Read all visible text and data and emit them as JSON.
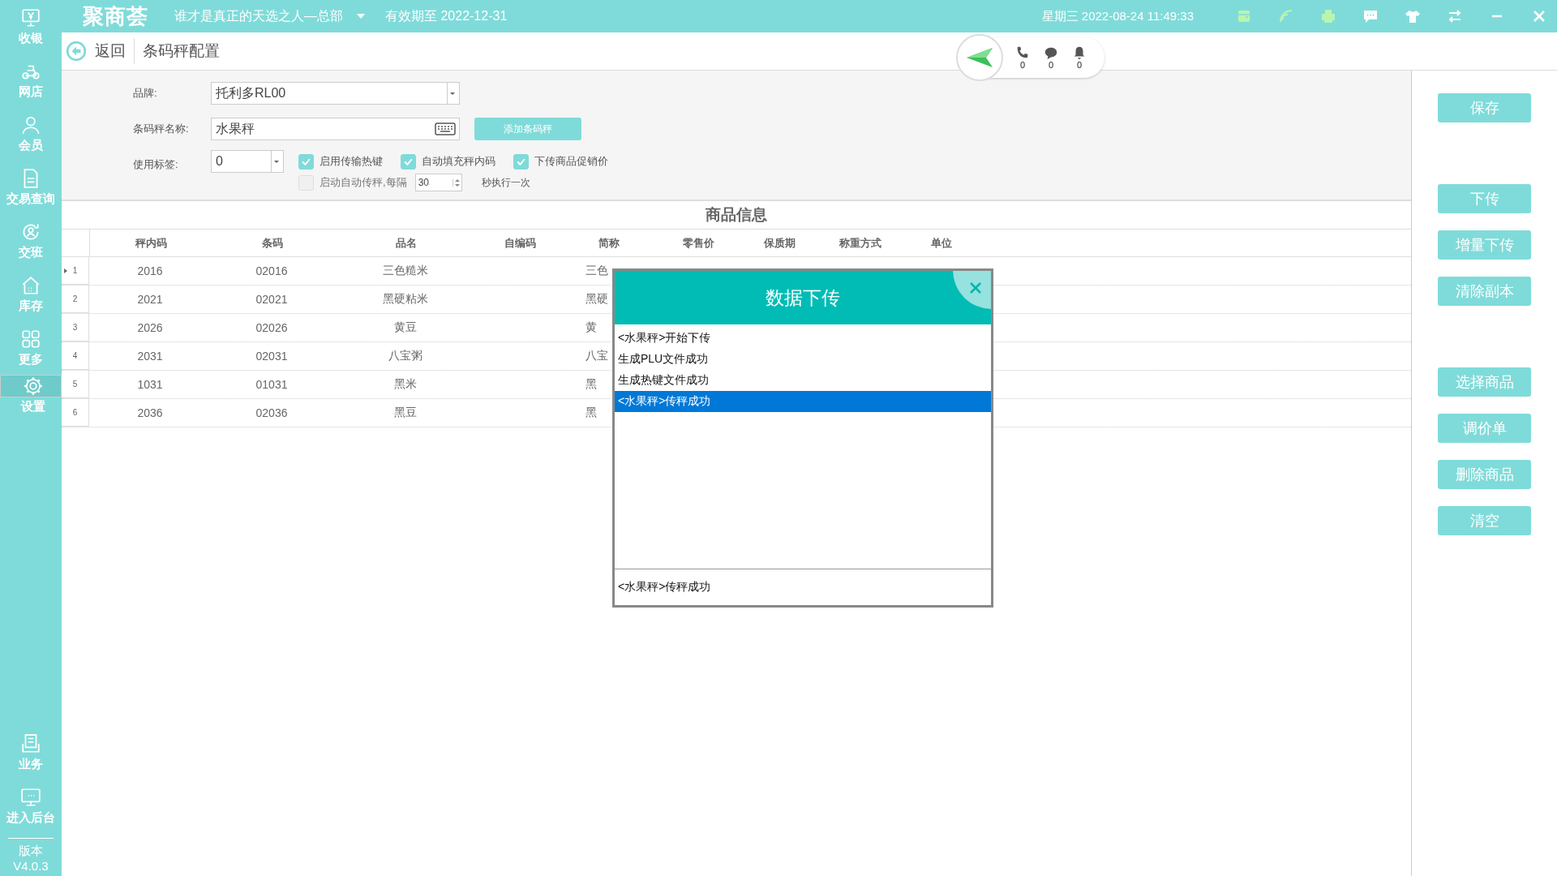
{
  "app": {
    "logo": "聚商荟",
    "store": "谁才是真正的天选之人—总部",
    "expiry": "有效期至 2022-12-31",
    "datetime": "星期三 2022-08-24 11:49:33"
  },
  "sidebar": {
    "items": [
      {
        "label": "收银",
        "selected": false
      },
      {
        "label": "网店",
        "selected": false
      },
      {
        "label": "会员",
        "selected": false
      },
      {
        "label": "交易查询",
        "selected": false
      },
      {
        "label": "交班",
        "selected": false
      },
      {
        "label": "库存",
        "selected": false
      },
      {
        "label": "更多",
        "selected": false
      },
      {
        "label": "设置",
        "selected": true
      }
    ],
    "bottom_items": [
      {
        "label": "业务"
      },
      {
        "label": "进入后台"
      }
    ],
    "version_label": "版本",
    "version": "V4.0.3"
  },
  "notifications": [
    "0",
    "0",
    "0"
  ],
  "nav": {
    "back": "返回",
    "title": "条码秤配置"
  },
  "form": {
    "brand_label": "品牌:",
    "brand": "托利多RL00",
    "name_label": "条码秤名称:",
    "name": "水果秤",
    "add_button": "添加条码秤",
    "tag_label": "使用标签:",
    "tag": "0",
    "options": [
      {
        "label": "启用传输热键",
        "checked": true
      },
      {
        "label": "自动填充秤内码",
        "checked": true
      },
      {
        "label": "下传商品促销价",
        "checked": true
      }
    ],
    "auto": {
      "label": "启动自动传秤,每隔",
      "checked": false,
      "interval": "30",
      "suffix": "秒执行一次"
    }
  },
  "table": {
    "title": "商品信息",
    "columns": [
      "秤内码",
      "条码",
      "品名",
      "自编码",
      "简称",
      "零售价",
      "保质期",
      "称重方式",
      "单位"
    ],
    "rows": [
      {
        "index": "1",
        "selected": true,
        "cells": [
          "2016",
          "02016",
          "三色糙米",
          "",
          "三色"
        ]
      },
      {
        "index": "2",
        "selected": false,
        "cells": [
          "2021",
          "02021",
          "黑硬粘米",
          "",
          "黑硬"
        ]
      },
      {
        "index": "3",
        "selected": false,
        "cells": [
          "2026",
          "02026",
          "黄豆",
          "",
          "黄"
        ]
      },
      {
        "index": "4",
        "selected": false,
        "cells": [
          "2031",
          "02031",
          "八宝粥",
          "",
          "八宝"
        ]
      },
      {
        "index": "5",
        "selected": false,
        "cells": [
          "1031",
          "01031",
          "黑米",
          "",
          "黑"
        ]
      },
      {
        "index": "6",
        "selected": false,
        "cells": [
          "2036",
          "02036",
          "黑豆",
          "",
          "黑"
        ]
      }
    ]
  },
  "dialog": {
    "title": "数据下传",
    "lines": [
      {
        "text": "<水果秤>开始下传",
        "selected": false
      },
      {
        "text": "生成PLU文件成功",
        "selected": false
      },
      {
        "text": "生成热键文件成功",
        "selected": false
      },
      {
        "text": "<水果秤>传秤成功",
        "selected": true
      }
    ],
    "status": "<水果秤>传秤成功"
  },
  "actions": [
    [
      "保存"
    ],
    [
      "下传",
      "增量下传",
      "清除副本"
    ],
    [
      "选择商品",
      "调价单",
      "删除商品",
      "清空"
    ]
  ]
}
